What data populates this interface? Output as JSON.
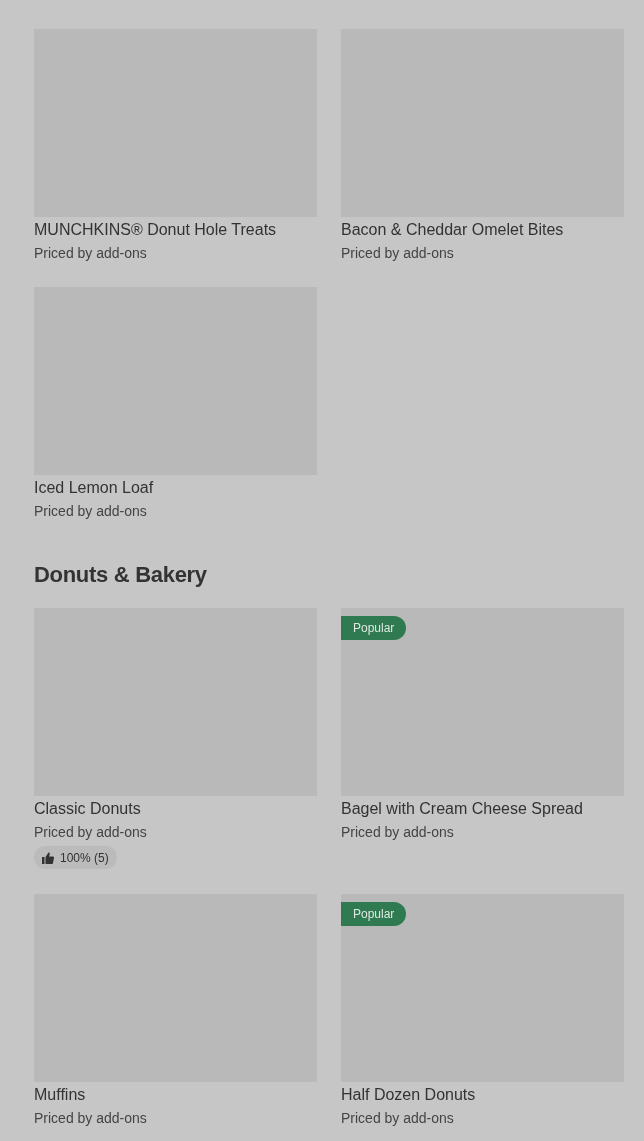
{
  "sections": [
    {
      "items": [
        {
          "name": "MUNCHKINS® Donut Hole Treats",
          "price": "Priced by add-ons"
        },
        {
          "name": "Bacon & Cheddar Omelet Bites",
          "price": "Priced by add-ons"
        },
        {
          "name": "Iced Lemon Loaf",
          "price": "Priced by add-ons"
        }
      ]
    },
    {
      "title": "Donuts & Bakery",
      "items": [
        {
          "name": "Classic Donuts",
          "price": "Priced by add-ons",
          "rating": "100% (5)"
        },
        {
          "name": "Bagel with Cream Cheese Spread",
          "price": "Priced by add-ons",
          "badge": "Popular"
        },
        {
          "name": "Muffins",
          "price": "Priced by add-ons"
        },
        {
          "name": "Half Dozen Donuts",
          "price": "Priced by add-ons",
          "badge": "Popular"
        }
      ]
    }
  ]
}
